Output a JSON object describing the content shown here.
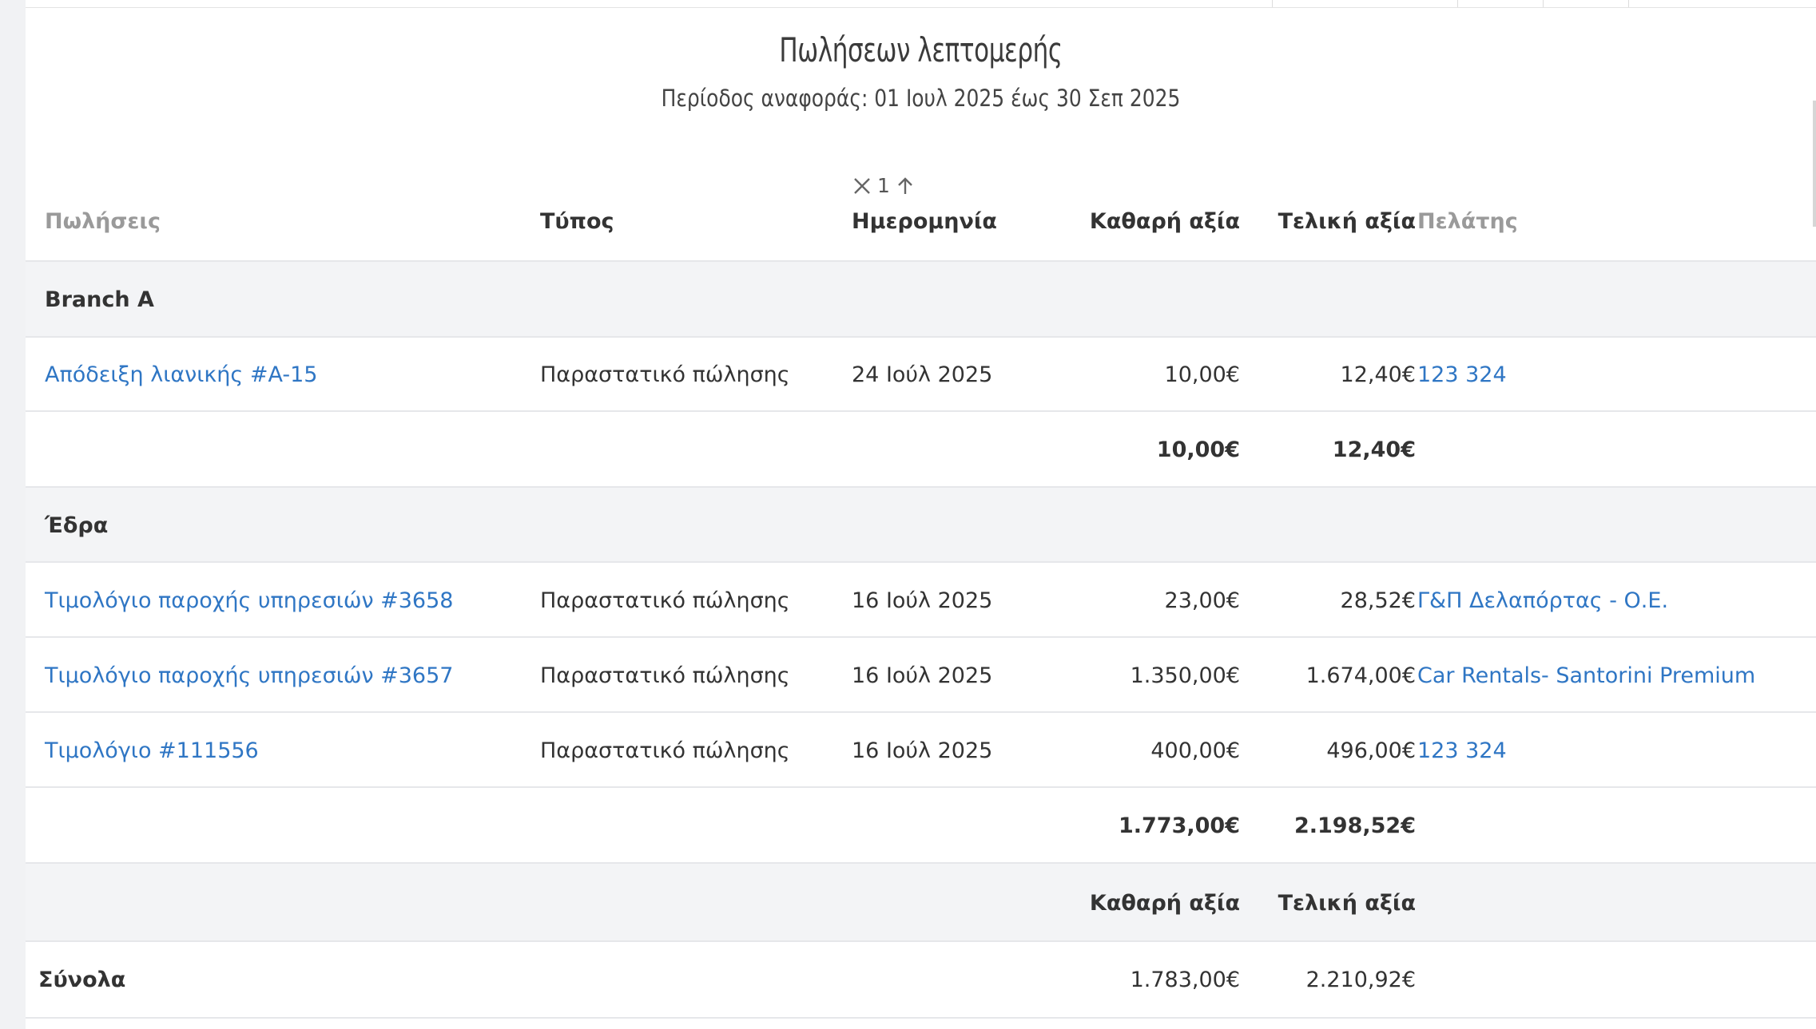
{
  "report": {
    "title": "Πωλήσεων λεπτομερής",
    "period": "Περίοδος αναφοράς: 01 Ιουλ 2025 έως 30 Σεπ 2025"
  },
  "sort": {
    "order": "1",
    "clear_icon": "close-icon",
    "direction_icon": "arrow-up-icon"
  },
  "columns": {
    "sales": "Πωλήσεις",
    "type": "Τύπος",
    "date": "Ημερομηνία",
    "net": "Καθαρή αξία",
    "gross": "Τελική αξία",
    "customer": "Πελάτης"
  },
  "groups": [
    {
      "name": "Branch A",
      "rows": [
        {
          "sales": "Απόδειξη λιανικής #A-15",
          "type": "Παραστατικό πώλησης",
          "date": "24 Ιούλ 2025",
          "net": "10,00€",
          "gross": "12,40€",
          "customer": "123 324"
        }
      ],
      "subtotal": {
        "net": "10,00€",
        "gross": "12,40€"
      }
    },
    {
      "name": "Έδρα",
      "rows": [
        {
          "sales": "Τιμολόγιο παροχής υπηρεσιών #3658",
          "type": "Παραστατικό πώλησης",
          "date": "16 Ιούλ 2025",
          "net": "23,00€",
          "gross": "28,52€",
          "customer": "Γ&Π Δελαπόρτας - Ο.Ε."
        },
        {
          "sales": "Τιμολόγιο παροχής υπηρεσιών #3657",
          "type": "Παραστατικό πώλησης",
          "date": "16 Ιούλ 2025",
          "net": "1.350,00€",
          "gross": "1.674,00€",
          "customer": "Car Rentals- Santorini Premium"
        },
        {
          "sales": "Τιμολόγιο #111556",
          "type": "Παραστατικό πώλησης",
          "date": "16 Ιούλ 2025",
          "net": "400,00€",
          "gross": "496,00€",
          "customer": "123 324"
        }
      ],
      "subtotal": {
        "net": "1.773,00€",
        "gross": "2.198,52€"
      }
    }
  ],
  "totals": {
    "header_net": "Καθαρή αξία",
    "header_gross": "Τελική αξία",
    "label": "Σύνολα",
    "net": "1.783,00€",
    "gross": "2.210,92€"
  }
}
